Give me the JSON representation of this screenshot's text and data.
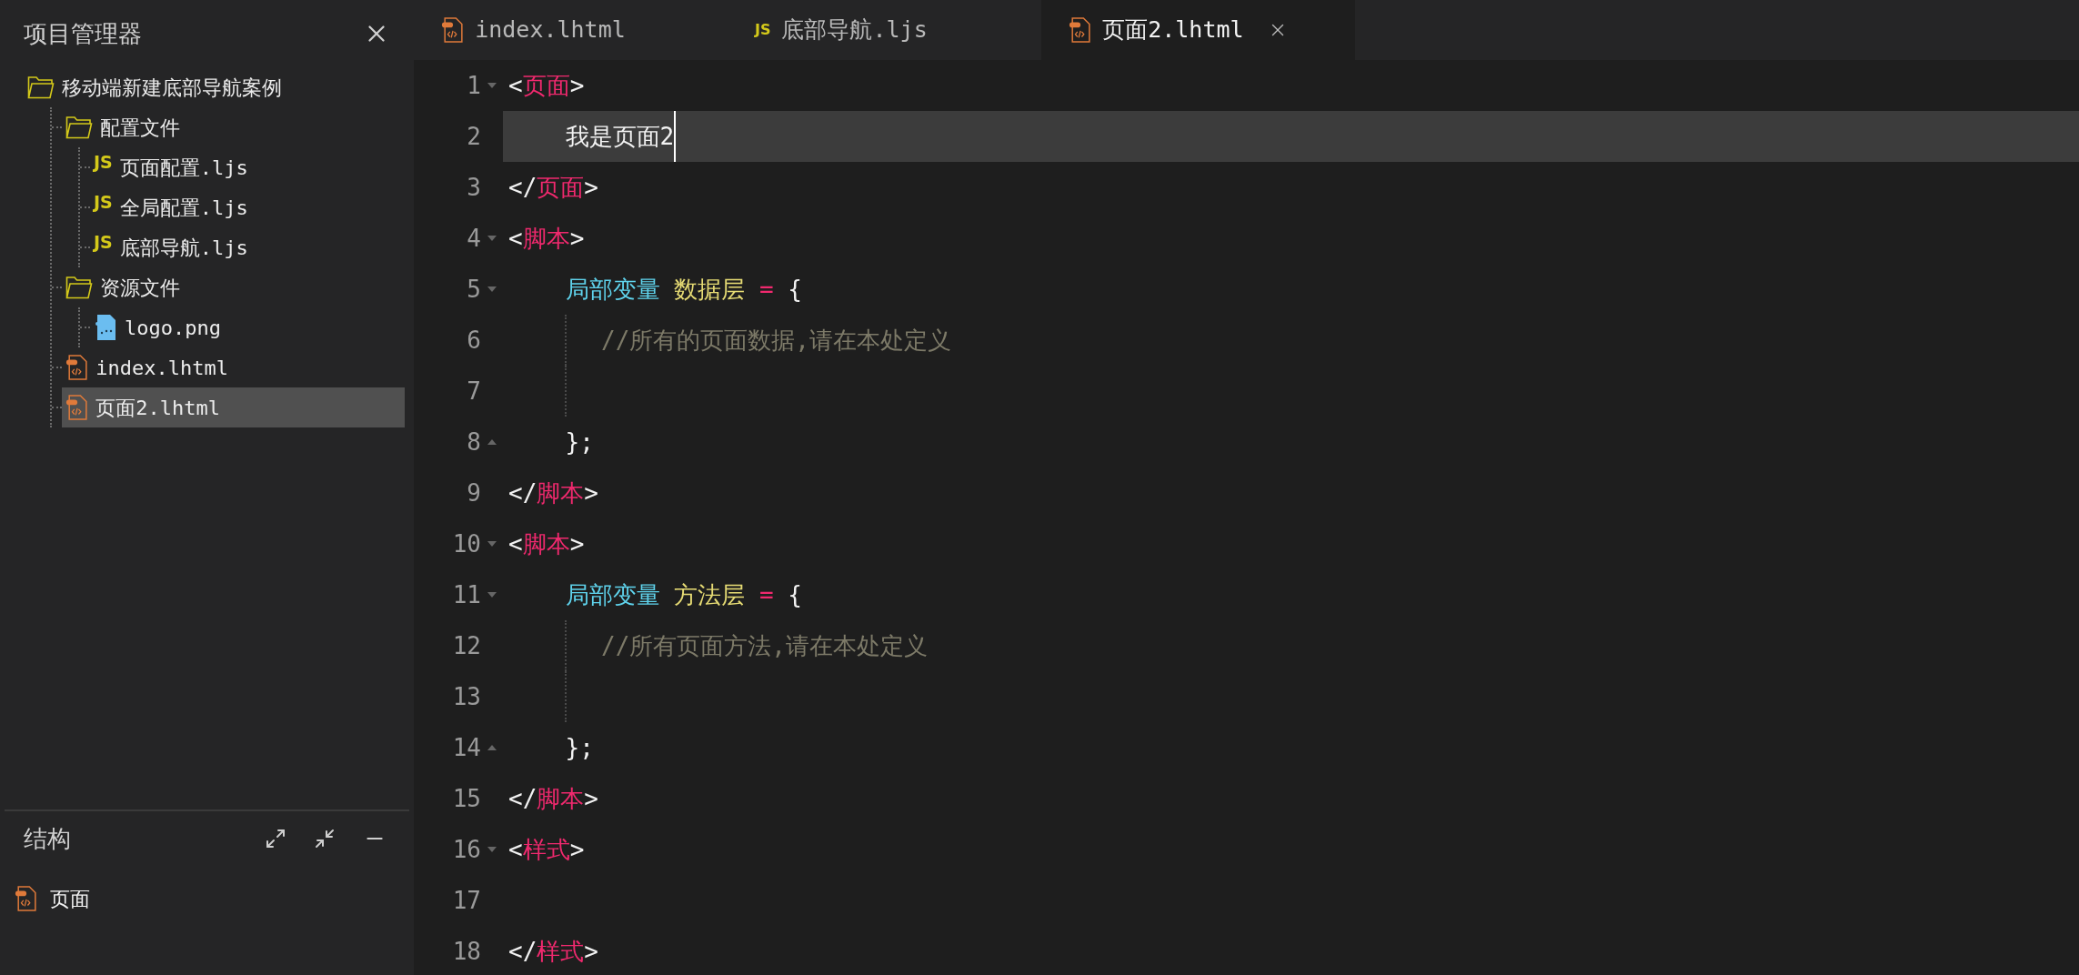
{
  "sidebar": {
    "title": "项目管理器",
    "tree": [
      {
        "kind": "folder",
        "label": "移动端新建底部导航案例",
        "selected": false,
        "children": [
          {
            "kind": "folder",
            "label": "配置文件",
            "selected": false,
            "children": [
              {
                "kind": "js",
                "icon_label": "JS",
                "label": "页面配置.ljs",
                "selected": false
              },
              {
                "kind": "js",
                "icon_label": "JS",
                "label": "全局配置.ljs",
                "selected": false
              },
              {
                "kind": "js",
                "icon_label": "JS",
                "label": "底部导航.ljs",
                "selected": false
              }
            ]
          },
          {
            "kind": "folder",
            "label": "资源文件",
            "selected": false,
            "children": [
              {
                "kind": "image",
                "label": "logo.png",
                "selected": false
              }
            ]
          },
          {
            "kind": "html",
            "label": "index.lhtml",
            "selected": false
          },
          {
            "kind": "html",
            "label": "页面2.lhtml",
            "selected": true
          }
        ]
      }
    ]
  },
  "structure": {
    "title": "结构",
    "items": [
      {
        "kind": "html",
        "label": "页面"
      }
    ]
  },
  "tabs": [
    {
      "kind": "html",
      "label": "index.lhtml",
      "selected": false
    },
    {
      "kind": "js",
      "icon_label": "JS",
      "label": "底部导航.ljs",
      "selected": false
    },
    {
      "kind": "html",
      "label": "页面2.lhtml",
      "selected": true
    }
  ],
  "editor": {
    "lines": [
      {
        "number": "1",
        "fold_start": true,
        "selected": false,
        "tokens": [
          {
            "kind": "punct",
            "text": "<"
          },
          {
            "kind": "tag",
            "text": "页面"
          },
          {
            "kind": "punct",
            "text": ">"
          }
        ]
      },
      {
        "number": "2",
        "selected": true,
        "tokens": [
          {
            "kind": "text",
            "text": "    我是页面2"
          }
        ]
      },
      {
        "number": "3",
        "selected": false,
        "tokens": [
          {
            "kind": "punct",
            "text": "</"
          },
          {
            "kind": "tag",
            "text": "页面"
          },
          {
            "kind": "punct",
            "text": ">"
          }
        ]
      },
      {
        "number": "4",
        "fold_start": true,
        "selected": false,
        "tokens": [
          {
            "kind": "punct",
            "text": "<"
          },
          {
            "kind": "tag",
            "text": "脚本"
          },
          {
            "kind": "punct",
            "text": ">"
          }
        ]
      },
      {
        "number": "5",
        "fold_start": true,
        "selected": false,
        "tokens": [
          {
            "kind": "keyword",
            "text": "    局部变量"
          },
          {
            "kind": "ident",
            "text": " 数据层"
          },
          {
            "kind": "op",
            "text": " ="
          },
          {
            "kind": "punct",
            "text": " {"
          }
        ]
      },
      {
        "number": "6",
        "guide": true,
        "selected": false,
        "tokens": [
          {
            "kind": "comment",
            "text": "//所有的页面数据,请在本处定义"
          }
        ]
      },
      {
        "number": "7",
        "guide": true,
        "selected": false
      },
      {
        "number": "8",
        "fold_end": true,
        "selected": false,
        "tokens": [
          {
            "kind": "punct",
            "text": "    };"
          }
        ]
      },
      {
        "number": "9",
        "selected": false,
        "tokens": [
          {
            "kind": "punct",
            "text": "</"
          },
          {
            "kind": "tag",
            "text": "脚本"
          },
          {
            "kind": "punct",
            "text": ">"
          }
        ]
      },
      {
        "number": "10",
        "fold_start": true,
        "selected": false,
        "tokens": [
          {
            "kind": "punct",
            "text": "<"
          },
          {
            "kind": "tag",
            "text": "脚本"
          },
          {
            "kind": "punct",
            "text": ">"
          }
        ]
      },
      {
        "number": "11",
        "fold_start": true,
        "selected": false,
        "tokens": [
          {
            "kind": "keyword",
            "text": "    局部变量"
          },
          {
            "kind": "ident",
            "text": " 方法层"
          },
          {
            "kind": "op",
            "text": " ="
          },
          {
            "kind": "punct",
            "text": " {"
          }
        ]
      },
      {
        "number": "12",
        "guide": true,
        "selected": false,
        "tokens": [
          {
            "kind": "comment",
            "text": "//所有页面方法,请在本处定义"
          }
        ]
      },
      {
        "number": "13",
        "guide": true,
        "selected": false
      },
      {
        "number": "14",
        "fold_end": true,
        "selected": false,
        "tokens": [
          {
            "kind": "punct",
            "text": "    };"
          }
        ]
      },
      {
        "number": "15",
        "selected": false,
        "tokens": [
          {
            "kind": "punct",
            "text": "</"
          },
          {
            "kind": "tag",
            "text": "脚本"
          },
          {
            "kind": "punct",
            "text": ">"
          }
        ]
      },
      {
        "number": "16",
        "fold_start": true,
        "selected": false,
        "tokens": [
          {
            "kind": "punct",
            "text": "<"
          },
          {
            "kind": "tag",
            "text": "样式"
          },
          {
            "kind": "punct",
            "text": ">"
          }
        ]
      },
      {
        "number": "17",
        "selected": false
      },
      {
        "number": "18",
        "selected": false,
        "tokens": [
          {
            "kind": "punct",
            "text": "</"
          },
          {
            "kind": "tag",
            "text": "样式"
          },
          {
            "kind": "punct",
            "text": ">"
          }
        ]
      }
    ]
  }
}
